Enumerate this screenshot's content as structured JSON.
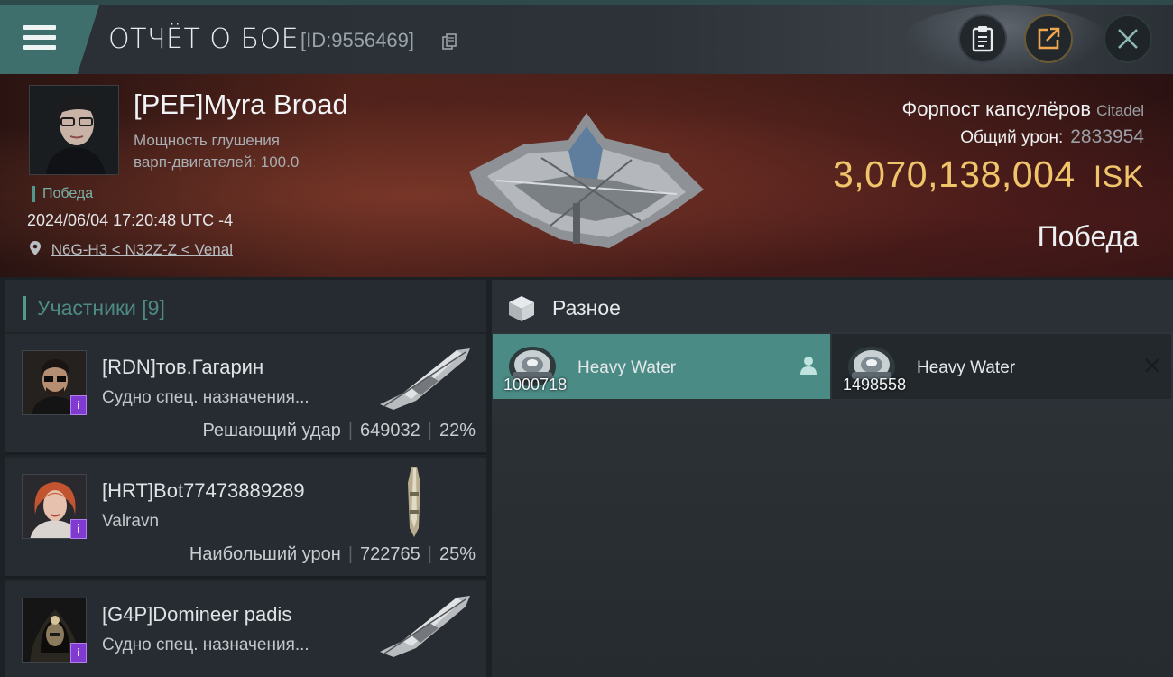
{
  "header": {
    "title": "ОТЧЁТ О БОЕ",
    "report_id": "[ID:9556469]"
  },
  "victim": {
    "name": "[PEF]Myra Broad",
    "subtitle_line1": "Мощность глушения",
    "subtitle_line2": "варп-двигателей: 100.0",
    "status": "Победа",
    "timestamp": "2024/06/04 17:20:48 UTC -4",
    "location": "N6G-H3 < N32Z-Z < Venal"
  },
  "summary": {
    "ship_name": "Форпост капсулёров",
    "ship_class": "Citadel",
    "damage_label": "Общий урон:",
    "damage_value": "2833954",
    "isk_value": "3,070,138,004",
    "isk_unit": "ISK",
    "result": "Победа"
  },
  "participants": {
    "title": "Участники [9]",
    "rows": [
      {
        "name": "[RDN]тов.Гагарин",
        "ship": "Судно спец. назначения...",
        "role": "Решающий удар",
        "damage": "649032",
        "percent": "22%",
        "badge": "i"
      },
      {
        "name": "[HRT]Bot77473889289",
        "ship": "Valravn",
        "role": "Наибольший урон",
        "damage": "722765",
        "percent": "25%",
        "badge": "i"
      },
      {
        "name": "[G4P]Domineer padis",
        "ship": "Судно спец. назначения...",
        "role": "",
        "damage": "",
        "percent": "",
        "badge": "i"
      }
    ]
  },
  "misc": {
    "title": "Разное",
    "items": [
      {
        "name": "Heavy Water",
        "quantity": "1000718"
      },
      {
        "name": "Heavy Water",
        "quantity": "1498558"
      }
    ]
  },
  "colors": {
    "accent_teal": "#4a8b86",
    "isk_gold": "#f0c46a",
    "badge_purple": "#7f3bd0"
  }
}
